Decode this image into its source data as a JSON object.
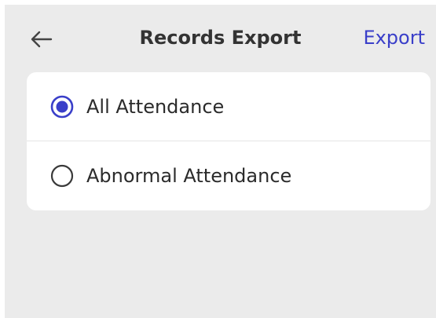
{
  "header": {
    "title": "Records Export",
    "action_label": "Export",
    "back_icon": "arrow-left-icon"
  },
  "options": [
    {
      "label": "All Attendance",
      "selected": true
    },
    {
      "label": "Abnormal Attendance",
      "selected": false
    }
  ],
  "colors": {
    "accent": "#3a3fc9",
    "background": "#ebebeb",
    "card": "#ffffff",
    "text": "#2b2b2b"
  }
}
